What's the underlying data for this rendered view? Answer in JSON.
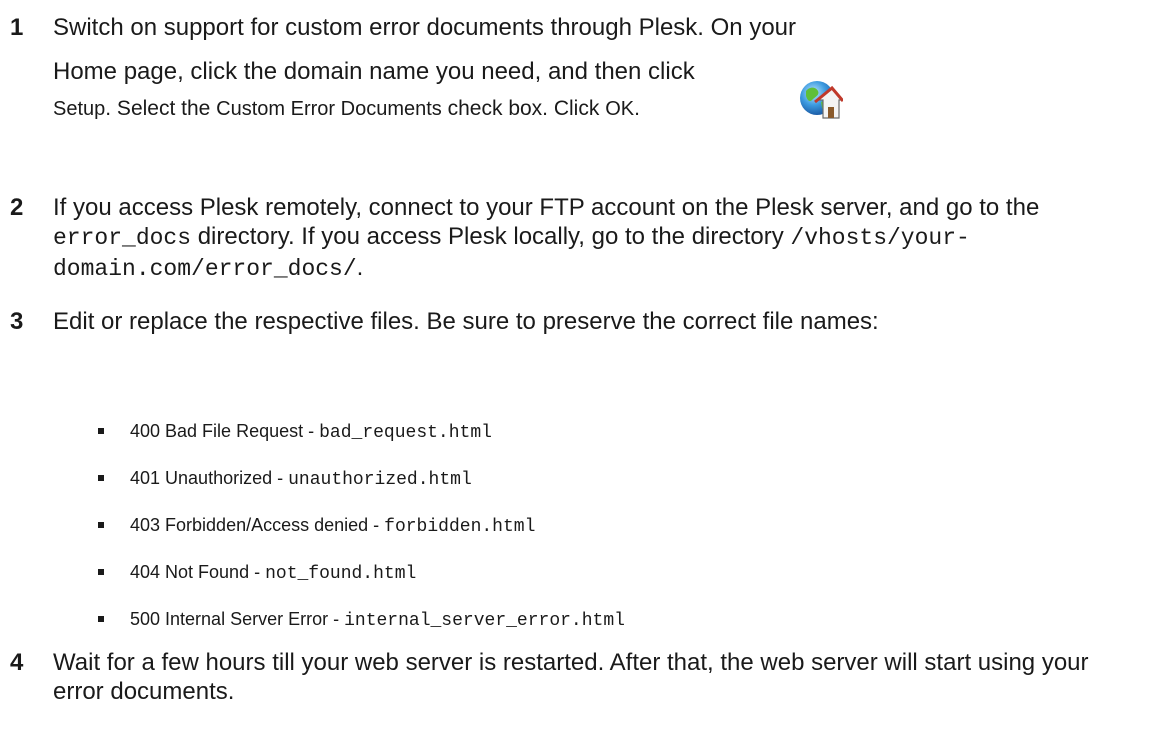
{
  "steps": [
    {
      "number": "1",
      "line1": "Switch on support for custom error documents through Plesk. On your",
      "line2": "Home page, click the domain name you need, and then click",
      "line3_a": "Setup",
      "line3_b": ". Select the ",
      "line3_c": "Custom Error Documents",
      "line3_d": " check box. Click ",
      "line3_e": "OK",
      "line3_f": "."
    },
    {
      "number": "2",
      "a": "If you access Plesk remotely, connect to your FTP account on the Plesk server, and go to the ",
      "code1": "error_docs",
      "b": " directory. If you access Plesk locally, go to the directory ",
      "code2": "/vhosts/your-domain.com/error_docs/",
      "c": "."
    },
    {
      "number": "3",
      "text": "Edit or replace the respective files. Be sure to preserve the correct file names:"
    },
    {
      "number": "4",
      "text": "Wait for a few hours till your web server is restarted. After that, the web server will start using your error documents."
    }
  ],
  "files": [
    {
      "label": "400 Bad File Request - ",
      "file": "bad_request.html"
    },
    {
      "label": "401 Unauthorized - ",
      "file": "unauthorized.html"
    },
    {
      "label": "403 Forbidden/Access denied - ",
      "file": "forbidden.html"
    },
    {
      "label": "404 Not Found - ",
      "file": "not_found.html"
    },
    {
      "label": "500 Internal Server Error - ",
      "file": "internal_server_error.html"
    }
  ],
  "icons": {
    "setup": "globe-home-icon"
  }
}
